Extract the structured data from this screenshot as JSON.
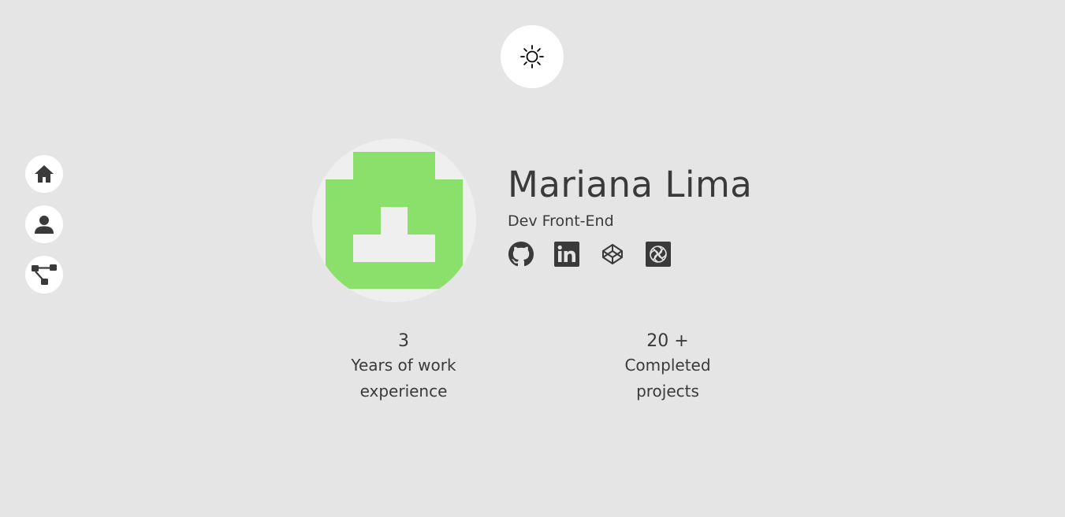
{
  "theme_toggle": {
    "icon": "sun-icon"
  },
  "side_nav": {
    "items": [
      {
        "icon": "home-icon"
      },
      {
        "icon": "user-icon"
      },
      {
        "icon": "projects-tree-icon"
      }
    ]
  },
  "profile": {
    "name": "Mariana Lima",
    "role": "Dev Front-End",
    "avatar_colors": {
      "background": "#efefef",
      "pixel": "#8be06b"
    },
    "socials": [
      {
        "icon": "github-icon"
      },
      {
        "icon": "linkedin-icon"
      },
      {
        "icon": "codepen-icon"
      },
      {
        "icon": "codesandbox-icon"
      }
    ]
  },
  "stats": {
    "years_value": "3",
    "years_label_line1": "Years of work",
    "years_label_line2": "experience",
    "projects_value": "20 +",
    "projects_label_line1": "Completed",
    "projects_label_line2": "projects"
  },
  "colors": {
    "background": "#e5e5e5",
    "text": "#3a3a3a",
    "button": "#ffffff"
  }
}
